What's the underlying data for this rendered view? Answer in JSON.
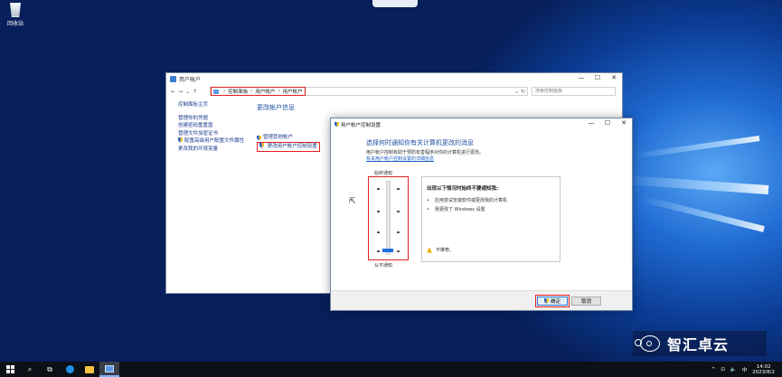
{
  "desktop": {
    "recycle_bin_label": "回收站"
  },
  "cp_window": {
    "title": "用户帐户",
    "controls": {
      "minimize": "—",
      "maximize": "☐",
      "close": "✕"
    },
    "nav": {
      "back": "←",
      "forward": "→",
      "recent": "⌄",
      "up": "↑"
    },
    "breadcrumb": [
      "控制面板",
      "用户帐户",
      "用户帐户"
    ],
    "breadcrumb_sep": "›",
    "search_placeholder": "搜索控制面板",
    "sidebar": {
      "home": "控制面板主页",
      "items": [
        "管理你的凭据",
        "创建密码重置盘",
        "管理文件加密证书",
        "配置高级用户配置文件属性",
        "更改我的环境变量"
      ]
    },
    "main": {
      "heading": "更改帐户信息",
      "links": [
        "管理其他帐户",
        "更改用户帐户控制设置"
      ]
    }
  },
  "uac_dialog": {
    "title": "用户帐户控制设置",
    "controls": {
      "minimize": "—",
      "maximize": "☐",
      "close": "✕"
    },
    "heading": "选择何时通知你有关计算机更改的消息",
    "description": "用户帐户控制有助于预防有害程序对你的计算机进行更改。",
    "link": "有关用户帐户控制设置的详细信息",
    "slider": {
      "top_label": "始终通知",
      "bottom_label": "从不通知",
      "levels": 4,
      "selected_level": 1
    },
    "info": {
      "title": "出现以下情况时始终不要通知我:",
      "bullets": [
        "应用尝试安装软件或更改我的计算机",
        "我更改了 Windows 设置"
      ],
      "note": "不推荐。"
    },
    "ok_label": "确定",
    "cancel_label": "取消"
  },
  "watermark": {
    "text": "智汇卓云"
  },
  "taskbar": {
    "search_icon": "⌕",
    "task_view_icon": "⧉",
    "tray": {
      "chevron": "^",
      "network": "⊡",
      "volume": "🔈",
      "ime": "中"
    },
    "clock": {
      "time": "14:02",
      "date": "2023/8/2"
    }
  },
  "colors": {
    "highlight": "#e02020",
    "link": "#1a3a8c",
    "heading": "#1e4fa3",
    "slider_thumb": "#1a6fe0"
  }
}
